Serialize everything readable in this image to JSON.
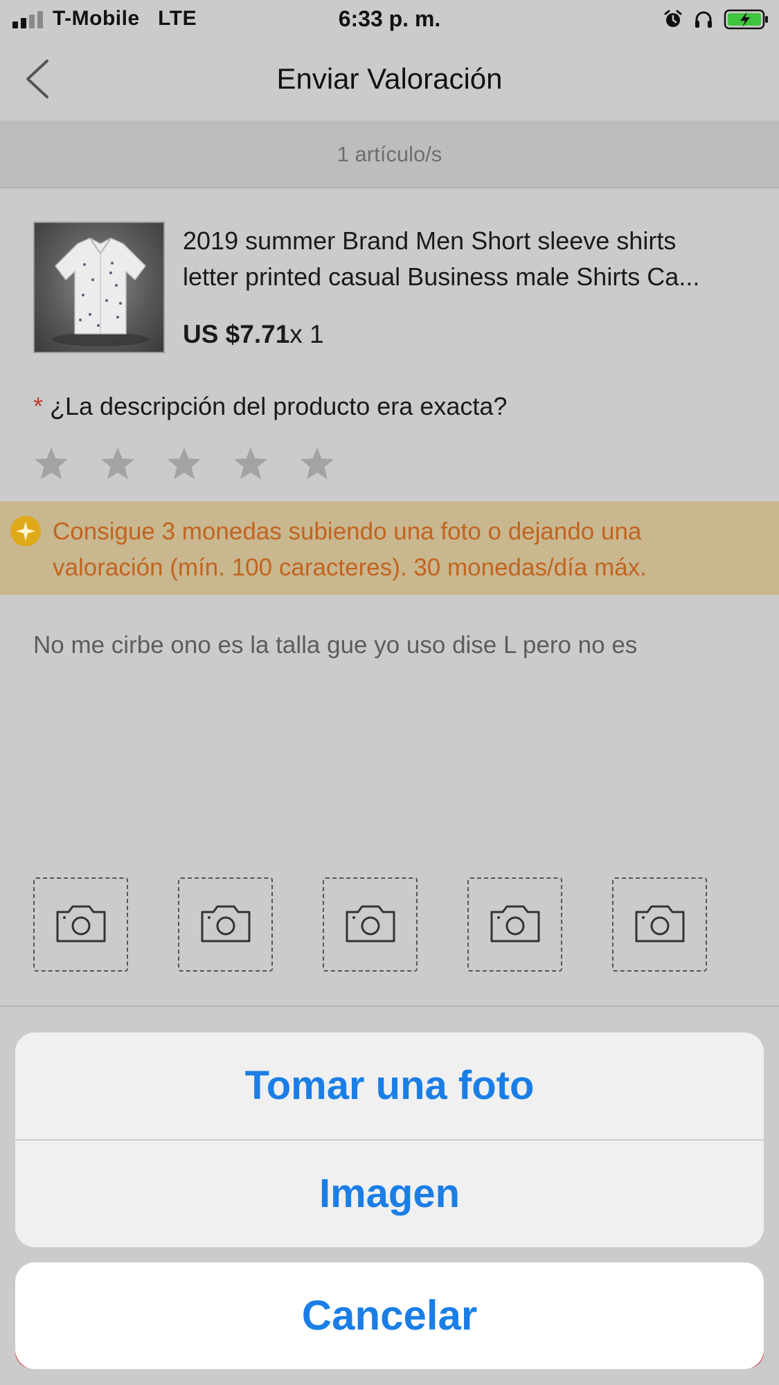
{
  "status_bar": {
    "carrier": "T-Mobile   LTE",
    "time": "6:33 p. m."
  },
  "nav": {
    "title": "Enviar Valoración"
  },
  "items_count": "1 artículo/s",
  "product": {
    "title_line1": "2019 summer Brand Men Short sleeve shirts",
    "title_line2": "letter printed casual Business male Shirts Ca...",
    "price": "US $7.71",
    "quantity": "x 1"
  },
  "rating": {
    "required_mark": "*",
    "question": "¿La descripción del producto era exacta?",
    "stars_total": 5,
    "stars_selected": 0
  },
  "coins_banner": {
    "line1": "Consigue 3 monedas subiendo una foto o dejando una",
    "line2": "valoración (mín. 100 caracteres). 30 monedas/día máx."
  },
  "review": {
    "text": "No me cirbe ono es la talla gue yo uso dise L pero no es"
  },
  "photo_slots_count": 5,
  "action_sheet": {
    "take_photo": "Tomar una foto",
    "image": "Imagen",
    "cancel": "Cancelar"
  },
  "colors": {
    "action_blue": "#1a7ee6",
    "banner_text": "#c2641f",
    "banner_bg": "#c9b78f",
    "battery_green": "#3ec43e"
  }
}
